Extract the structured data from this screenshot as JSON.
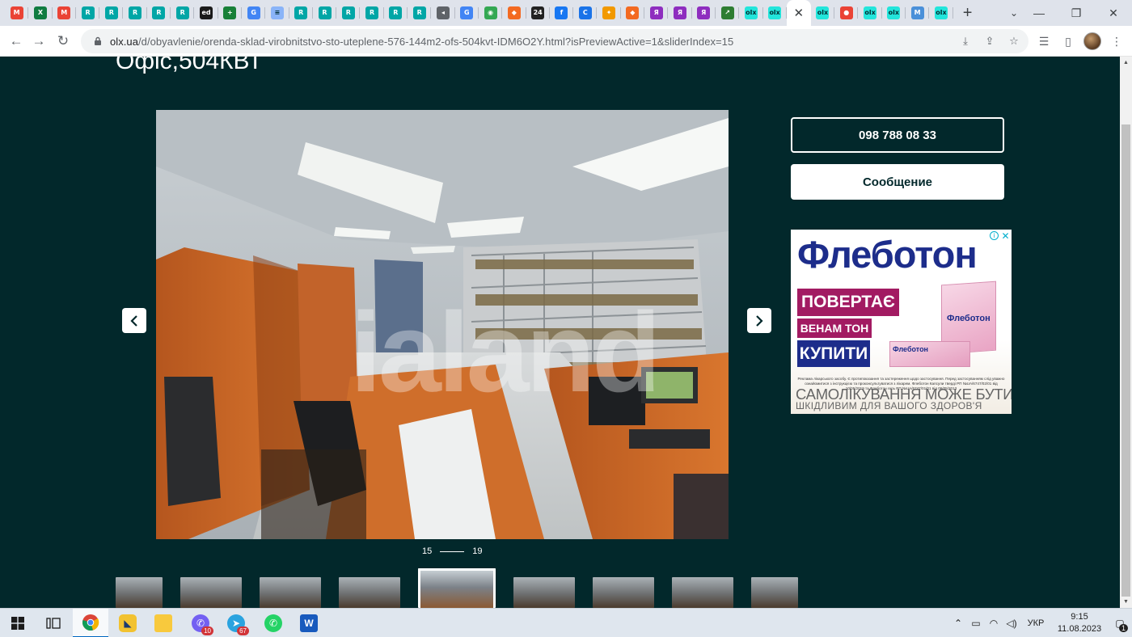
{
  "browser": {
    "tab_icons": [
      {
        "icon": "gmail-icon",
        "glyph": "M",
        "color": "#ea4335"
      },
      {
        "icon": "excel-icon",
        "glyph": "X",
        "color": "#107c41"
      },
      {
        "icon": "gmail-icon",
        "glyph": "M",
        "color": "#ea4335"
      },
      {
        "icon": "ria-icon",
        "glyph": "R",
        "color": "#00a6a6"
      },
      {
        "icon": "ria-icon",
        "glyph": "R",
        "color": "#00a6a6"
      },
      {
        "icon": "ria-icon",
        "glyph": "R",
        "color": "#00a6a6"
      },
      {
        "icon": "ria-icon",
        "glyph": "R",
        "color": "#00a6a6"
      },
      {
        "icon": "ria-icon",
        "glyph": "R",
        "color": "#00a6a6"
      },
      {
        "icon": "ed-icon",
        "glyph": "ed",
        "color": "#1a1a1a"
      },
      {
        "icon": "plus-green-icon",
        "glyph": "+",
        "color": "#188038"
      },
      {
        "icon": "translate-icon",
        "glyph": "G",
        "color": "#4285f4"
      },
      {
        "icon": "doc-icon",
        "glyph": "≡",
        "color": "#8ab4f8"
      },
      {
        "icon": "ria-icon",
        "glyph": "R",
        "color": "#00a6a6"
      },
      {
        "icon": "ria-icon",
        "glyph": "R",
        "color": "#00a6a6"
      },
      {
        "icon": "ria-icon",
        "glyph": "R",
        "color": "#00a6a6"
      },
      {
        "icon": "ria-icon",
        "glyph": "R",
        "color": "#00a6a6"
      },
      {
        "icon": "ria-icon",
        "glyph": "R",
        "color": "#00a6a6"
      },
      {
        "icon": "ria-icon",
        "glyph": "R",
        "color": "#00a6a6"
      },
      {
        "icon": "audio-icon",
        "glyph": "◂",
        "color": "#5f6368"
      },
      {
        "icon": "google-icon",
        "glyph": "G",
        "color": "#4285f4"
      },
      {
        "icon": "maps-icon",
        "glyph": "◉",
        "color": "#34a853"
      },
      {
        "icon": "cube-icon",
        "glyph": "◆",
        "color": "#f36a21"
      },
      {
        "icon": "24-icon",
        "glyph": "24",
        "color": "#222222"
      },
      {
        "icon": "facebook-icon",
        "glyph": "f",
        "color": "#1877f2"
      },
      {
        "icon": "c-icon",
        "glyph": "C",
        "color": "#1a73e8"
      },
      {
        "icon": "star-icon",
        "glyph": "✦",
        "color": "#f29900"
      },
      {
        "icon": "cube-icon",
        "glyph": "◆",
        "color": "#f36a21"
      },
      {
        "icon": "yandex-icon",
        "glyph": "Я",
        "color": "#8e2dbf"
      },
      {
        "icon": "yandex-icon",
        "glyph": "Я",
        "color": "#8e2dbf"
      },
      {
        "icon": "yandex-icon",
        "glyph": "Я",
        "color": "#8e2dbf"
      },
      {
        "icon": "chart-icon",
        "glyph": "↗",
        "color": "#2e7d32"
      },
      {
        "icon": "olx-icon",
        "glyph": "olx",
        "color": "#23e5db"
      },
      {
        "icon": "olx-icon",
        "glyph": "olx",
        "color": "#23e5db"
      },
      {
        "icon": "close-icon",
        "glyph": "✕",
        "color": "#ffffff",
        "active": true
      },
      {
        "icon": "olx-icon",
        "glyph": "olx",
        "color": "#23e5db"
      },
      {
        "icon": "location-pin-icon",
        "glyph": "●",
        "color": "#ea4335"
      },
      {
        "icon": "olx-icon",
        "glyph": "olx",
        "color": "#23e5db"
      },
      {
        "icon": "olx-icon",
        "glyph": "olx",
        "color": "#23e5db"
      },
      {
        "icon": "m-icon",
        "glyph": "M",
        "color": "#4a90d9"
      },
      {
        "icon": "olx-icon",
        "glyph": "olx",
        "color": "#23e5db"
      }
    ],
    "new_tab_label": "+",
    "address": {
      "host": "olx.ua",
      "path": "/d/obyavlenie/orenda-sklad-virobnitstvo-sto-uteplene-576-144m2-ofs-504kvt-IDM6O2Y.html?isPreviewActive=1&sliderIndex=15"
    }
  },
  "listing": {
    "title": "Офіс,504КВТ",
    "watermark": "ialand",
    "slider": {
      "current": "15",
      "total": "19"
    },
    "phone_button": "098 788 08 33",
    "message_button": "Сообщение",
    "thumbnail_count": 9,
    "active_thumbnail_index": 4
  },
  "ad": {
    "brand": "Флеботон",
    "line1": "ПОВЕРТАЄ",
    "line2": "ВЕНАМ ТОН",
    "line3": "КУПИТИ",
    "box_label": "Флеботон",
    "box_label_small": "Флеботон",
    "fine_print": "Реклама лікарського засобу. Є протипоказання та застереження щодо застосування. Перед застосуванням слід уважно ознайомитися з інструкцією та проконсультуватися з лікарем. Флеботон Капсули тверді РП №UA/6747/02/01 від 10/05/2019 та Флеботон гель РП №UA/6747/01/01 від 06/05/2013",
    "warning_line1": "САМОЛІКУВАННЯ МОЖЕ БУТИ",
    "warning_line2": "ШКІДЛИВИМ ДЛЯ ВАШОГО ЗДОРОВ'Я",
    "accent_blue": "#1d2d8b",
    "accent_magenta": "#a21b62"
  },
  "taskbar": {
    "apps": [
      {
        "icon": "start-icon"
      },
      {
        "icon": "task-view-icon"
      },
      {
        "icon": "chrome-icon",
        "active": true
      },
      {
        "icon": "app-icon"
      },
      {
        "icon": "file-explorer-icon"
      },
      {
        "icon": "viber-icon",
        "badge": "10"
      },
      {
        "icon": "telegram-icon",
        "badge": "67"
      },
      {
        "icon": "whatsapp-icon"
      },
      {
        "icon": "word-icon"
      }
    ],
    "language": "УКР",
    "time": "9:15",
    "date": "11.08.2023",
    "notifications": "1"
  },
  "colors": {
    "page_background": "#02282b",
    "tab_strip": "#dfe3eb"
  }
}
